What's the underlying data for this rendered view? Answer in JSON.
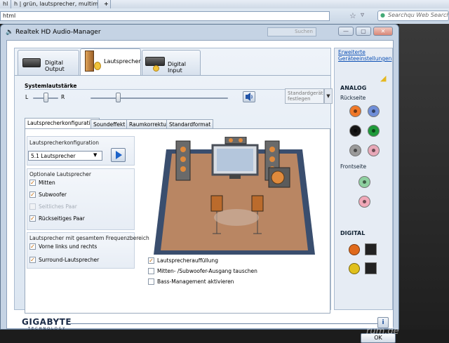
{
  "browser": {
    "tabs": [
      "hl",
      "h | grün, lautsprecher, multimedia..."
    ],
    "new_tab_symbol": "+",
    "url_fragment": "html",
    "search_placeholder": "Searchqu Web Search",
    "star_symbol": "☆",
    "arrow_symbol": "▿"
  },
  "dialog": {
    "title": "Realtek HD Audio-Manager",
    "title_input_text": "Suchen",
    "window_buttons": [
      "—",
      "▢",
      "✕"
    ]
  },
  "main_tabs": [
    "Digital Output",
    "Lautsprecher",
    "Digital Input"
  ],
  "volume": {
    "label": "Systemlautstärke",
    "balance_left": "L",
    "balance_right": "R",
    "balance_value": 0.5,
    "master_value": 0.2,
    "default_device": "Standardgerät festlegen"
  },
  "sub_tabs": [
    "Lautsprecherkonfiguration",
    "Soundeffekt",
    "Raumkorrektur",
    "Standardformat"
  ],
  "config": {
    "label": "Lautsprecherkonfiguration",
    "selected": "5.1 Lautsprecher"
  },
  "optional": {
    "title": "Optionale Lautsprecher",
    "items": [
      {
        "label": "Mitten",
        "checked": true,
        "disabled": false
      },
      {
        "label": "Subwoofer",
        "checked": true,
        "disabled": false
      },
      {
        "label": "Seitliches Paar",
        "checked": false,
        "disabled": true
      },
      {
        "label": "Rückseitiges Paar",
        "checked": true,
        "disabled": false
      }
    ]
  },
  "fullrange": {
    "title": "Lautsprecher mit gesamtem Frequenzbereich",
    "items": [
      {
        "label": "Vorne links und rechts",
        "checked": true
      },
      {
        "label": "Surround-Lautsprecher",
        "checked": true
      }
    ]
  },
  "bottom_options": [
    {
      "label": "Lautsprecherauffüllung",
      "checked": true
    },
    {
      "label": "Mitten- /Subwoofer-Ausgang tauschen",
      "checked": false
    },
    {
      "label": "Bass-Management aktivieren",
      "checked": false
    }
  ],
  "right_panel": {
    "advanced_link": "Erweiterte Geräteeinstellungen",
    "analog_label": "ANALOG",
    "rueckseite_label": "Rückseite",
    "frontseite_label": "Frontseite",
    "digital_label": "DIGITAL",
    "rear_jacks": [
      "#f07828",
      "#6f8ed8",
      "#161616",
      "#1e9a3a",
      "#9a9a9a",
      "#e8a8b8"
    ],
    "front_jacks": [
      "#8ed0a0",
      "#f0a8b8"
    ]
  },
  "footer": {
    "logo": "GIGABYTE",
    "logo_sub": "TECHNOLOGY",
    "info_symbol": "i",
    "ok_label": "OK",
    "watermark": "rum.de"
  }
}
